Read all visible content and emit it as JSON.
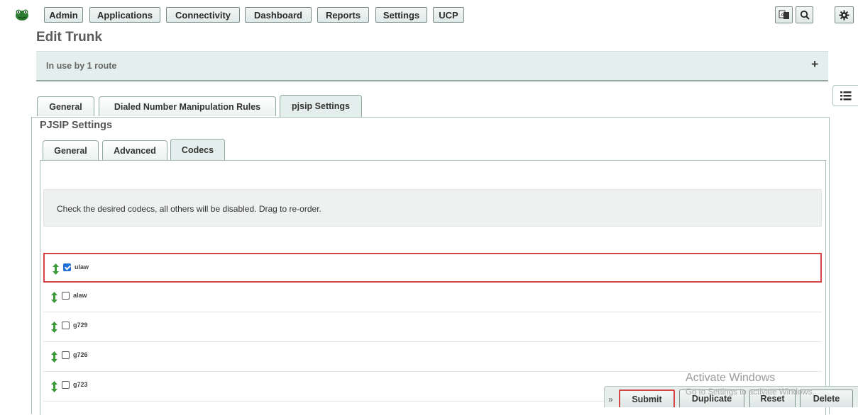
{
  "nav": {
    "items": [
      "Admin",
      "Applications",
      "Connectivity",
      "Dashboard",
      "Reports",
      "Settings",
      "UCP"
    ],
    "icons": [
      "logo-icon",
      "language-icon",
      "search-icon",
      "gear-icon"
    ]
  },
  "page": {
    "title": "Edit Trunk",
    "usage": "In use by 1 route",
    "usage_expand": "+"
  },
  "main_tabs": [
    "General",
    "Dialed Number Manipulation Rules",
    "pjsip Settings"
  ],
  "pjsip": {
    "title": "PJSIP Settings",
    "tabs": [
      "General",
      "Advanced",
      "Codecs"
    ],
    "help": "Check the desired codecs, all others will be disabled. Drag to re-order.",
    "codecs": [
      {
        "name": "ulaw",
        "checked": true
      },
      {
        "name": "alaw",
        "checked": false
      },
      {
        "name": "g729",
        "checked": false
      },
      {
        "name": "g726",
        "checked": false
      },
      {
        "name": "g723",
        "checked": false
      }
    ]
  },
  "watermark": {
    "title": "Activate Windows",
    "sub": "Go to Settings to activate Windows."
  },
  "actions": {
    "toggle": "»",
    "submit": "Submit",
    "duplicate": "Duplicate",
    "reset": "Reset",
    "delete": "Delete"
  },
  "colors": {
    "accent_bg": "#e4efed",
    "highlight": "#d64545",
    "checkbox": "#1f6fd6"
  }
}
